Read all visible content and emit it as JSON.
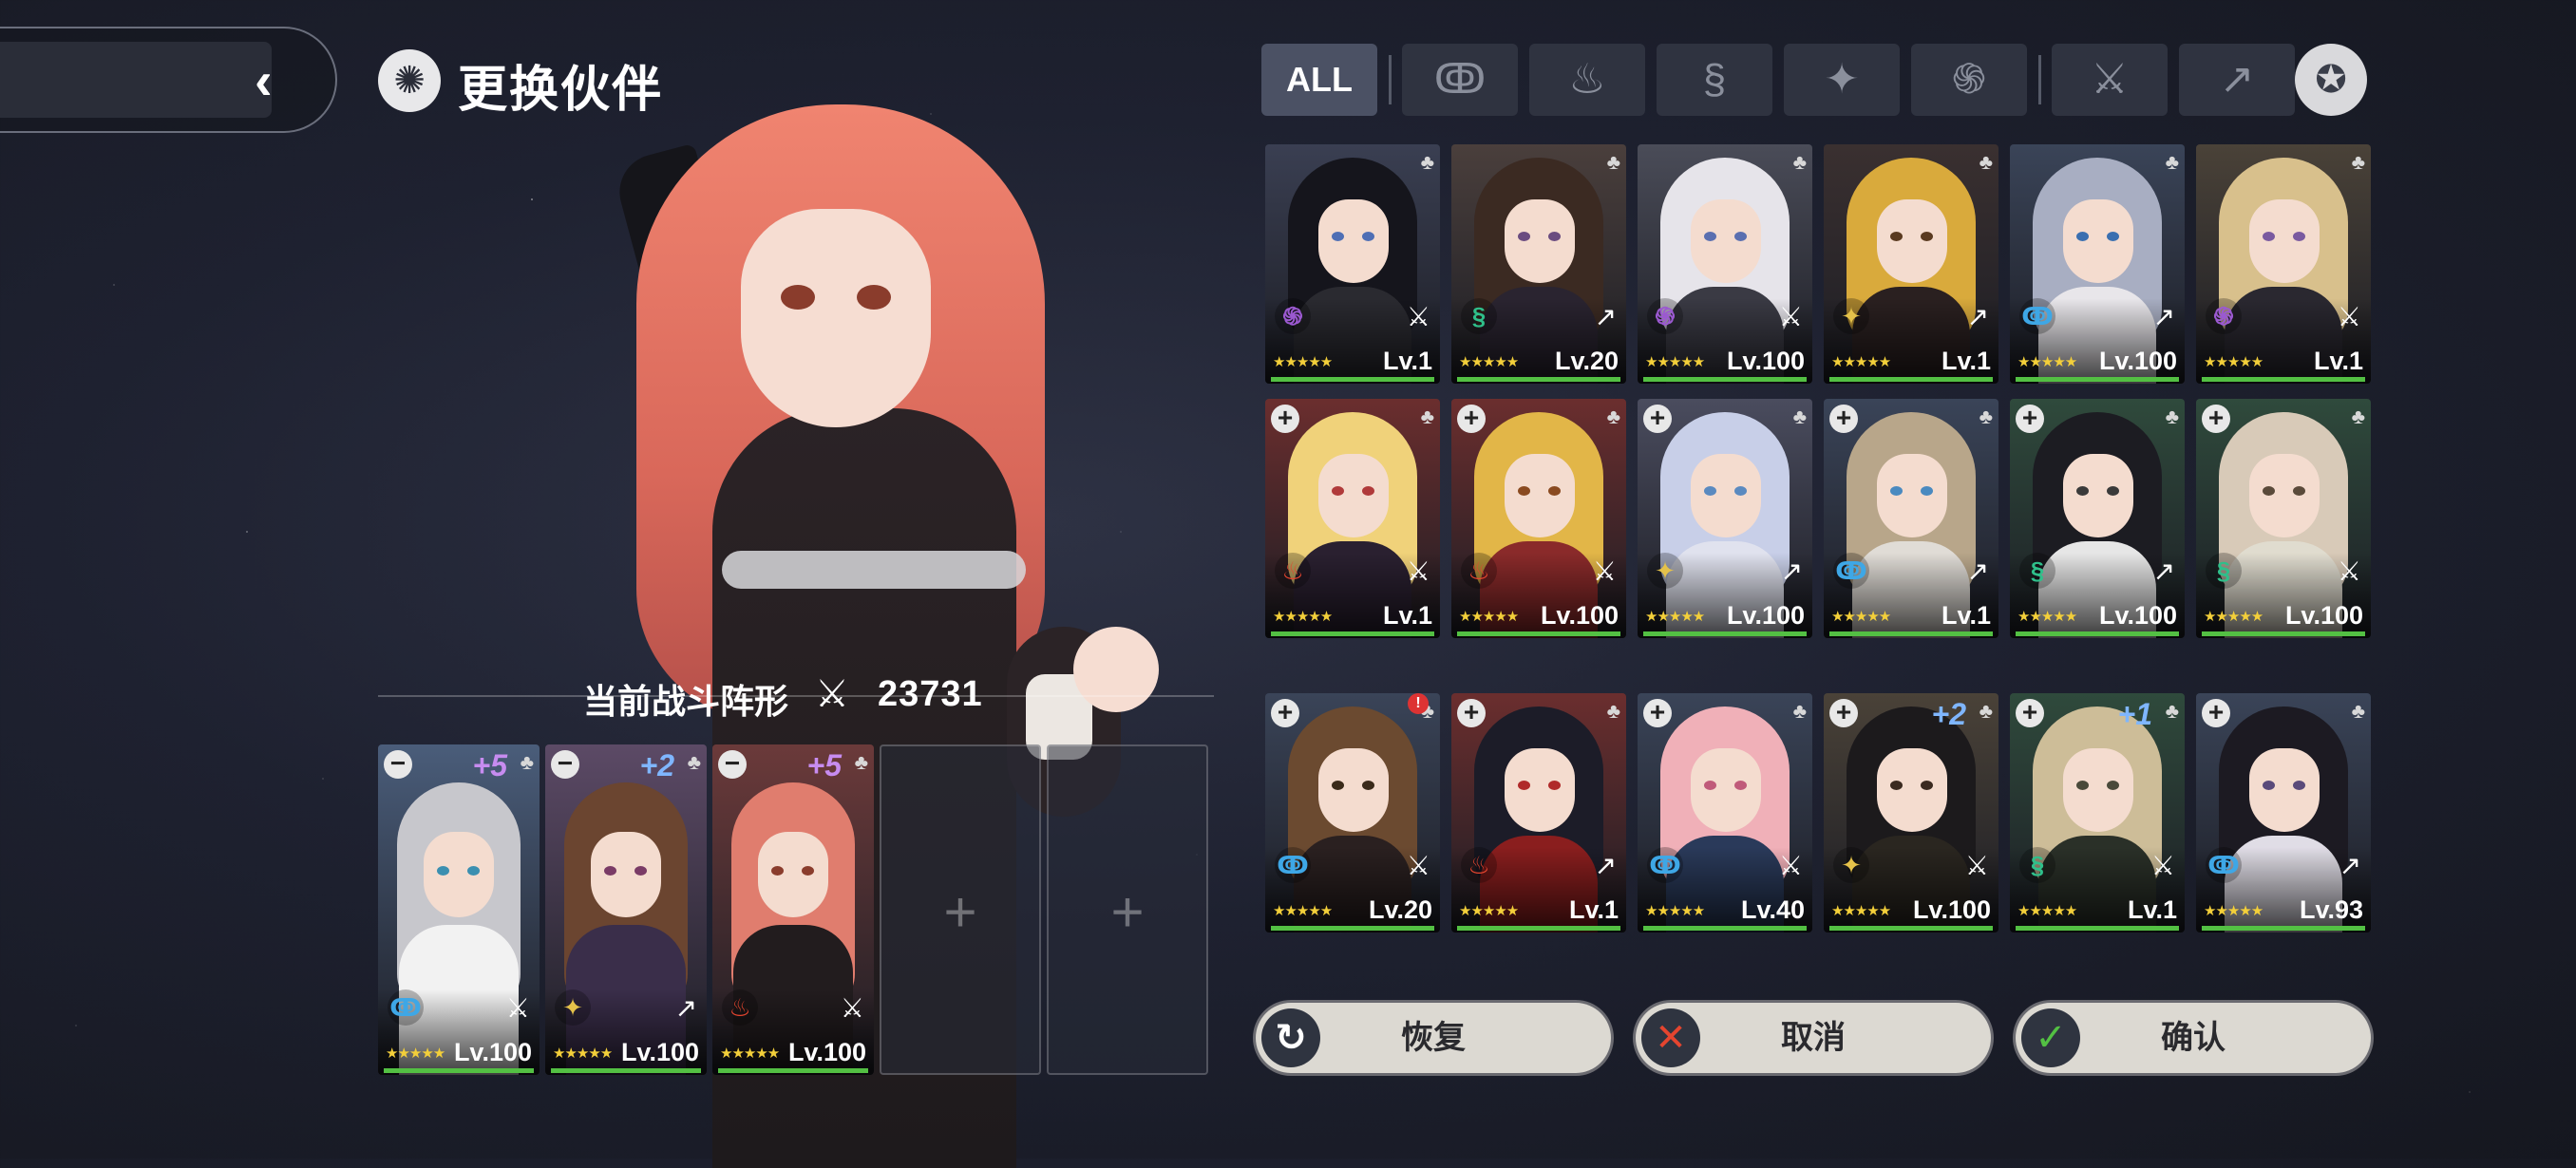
{
  "header": {
    "title": "更换伙伴"
  },
  "formation": {
    "label": "当前战斗阵形",
    "power": "23731"
  },
  "filters": [
    "ALL"
  ],
  "colors": {
    "water": "#3ea7e6",
    "fire": "#e5452f",
    "wind": "#2fbf8a",
    "light": "#e5c24a",
    "dark": "#9b59d0"
  },
  "team": [
    {
      "boost": "+5",
      "element": "water",
      "class": "sword",
      "stars": "★★★★★",
      "level": "Lv.100",
      "hair": "#c7c7cc",
      "bg": "#4a5d7a",
      "torso": "#f2f2f2",
      "eye": "#3b8fb0"
    },
    {
      "boost": "+2",
      "element": "light",
      "class": "lance",
      "stars": "★★★★★",
      "level": "Lv.100",
      "hair": "#6b4530",
      "bg": "#5c4a66",
      "torso": "#3a2e4a",
      "eye": "#7a3b66"
    },
    {
      "boost": "+5",
      "element": "fire",
      "class": "sword",
      "stars": "★★★★★",
      "level": "Lv.100",
      "hair": "#e07d6e",
      "bg": "#6b3a3a",
      "torso": "#221c1e",
      "eye": "#8a3c2c"
    }
  ],
  "roster": [
    {
      "element": "dark",
      "class": "sword",
      "stars": "★★★★★",
      "level": "Lv.1",
      "hair": "#15151c",
      "bg": "#3a3f52",
      "torso": "#2a2a30",
      "eye": "#4f6fb5",
      "action": "none"
    },
    {
      "element": "wind",
      "class": "lance",
      "stars": "★★★★★",
      "level": "Lv.20",
      "hair": "#3b2a22",
      "bg": "#4a3f3c",
      "torso": "#2a2430",
      "eye": "#6a4c80",
      "action": "none"
    },
    {
      "element": "dark",
      "class": "sword",
      "stars": "★★★★★",
      "level": "Lv.100",
      "hair": "#e6e4ea",
      "bg": "#4a4c58",
      "torso": "#3a3a44",
      "eye": "#5a6fb0",
      "action": "none"
    },
    {
      "element": "light",
      "class": "lance",
      "stars": "★★★★★",
      "level": "Lv.1",
      "hair": "#d9aa3c",
      "bg": "#3a3030",
      "torso": "#2a2020",
      "eye": "#5a3a20",
      "action": "none"
    },
    {
      "element": "water",
      "class": "lance",
      "stars": "★★★★★",
      "level": "Lv.100",
      "hair": "#a8aec2",
      "bg": "#3a4458",
      "torso": "#e8e6ea",
      "eye": "#3a6fb0",
      "action": "none"
    },
    {
      "element": "dark",
      "class": "sword",
      "stars": "★★★★★",
      "level": "Lv.1",
      "hair": "#d8c08c",
      "bg": "#4a4238",
      "torso": "#2a2830",
      "eye": "#7a5aa0",
      "action": "none"
    },
    {
      "element": "fire",
      "class": "sword",
      "stars": "★★★★★",
      "level": "Lv.1",
      "hair": "#f0d27a",
      "bg": "#6b2e2e",
      "torso": "#2a2030",
      "eye": "#b03a3a",
      "action": "add"
    },
    {
      "element": "fire",
      "class": "sword",
      "stars": "★★★★★",
      "level": "Lv.100",
      "hair": "#e2b648",
      "bg": "#6b2e2e",
      "torso": "#8a2a2a",
      "eye": "#8a4a20",
      "action": "add"
    },
    {
      "element": "light",
      "class": "lance",
      "stars": "★★★★★",
      "level": "Lv.100",
      "hair": "#c8cfe8",
      "bg": "#4a4c5e",
      "torso": "#e0e2ee",
      "eye": "#5a8ac0",
      "action": "add"
    },
    {
      "element": "water",
      "class": "lance",
      "stars": "★★★★★",
      "level": "Lv.1",
      "hair": "#b8a68a",
      "bg": "#3a4458",
      "torso": "#e0dcd6",
      "eye": "#4a8ac0",
      "action": "add"
    },
    {
      "element": "wind",
      "class": "lance",
      "stars": "★★★★★",
      "level": "Lv.100",
      "hair": "#1c1c22",
      "bg": "#2f4a3c",
      "torso": "#e6e6e6",
      "eye": "#3a3a3a",
      "action": "add"
    },
    {
      "element": "wind",
      "class": "sword",
      "stars": "★★★★★",
      "level": "Lv.100",
      "hair": "#d8cab8",
      "bg": "#2f4a3c",
      "torso": "#e0dccf",
      "eye": "#5a4a3a",
      "action": "add"
    },
    {
      "element": "water",
      "class": "sword",
      "stars": "★★★★★",
      "level": "Lv.20",
      "hair": "#6b4a30",
      "bg": "#3a4458",
      "torso": "#2a2020",
      "eye": "#3a2a1a",
      "action": "add",
      "alert": true
    },
    {
      "element": "fire",
      "class": "lance",
      "stars": "★★★★★",
      "level": "Lv.1",
      "hair": "#1c1c28",
      "bg": "#6b2e2e",
      "torso": "#8a1e1e",
      "eye": "#b02a2a",
      "action": "add"
    },
    {
      "element": "water",
      "class": "sword",
      "stars": "★★★★★",
      "level": "Lv.40",
      "hair": "#f0b0b8",
      "bg": "#3a4458",
      "torso": "#2a3a5a",
      "eye": "#c05a7a",
      "action": "add"
    },
    {
      "element": "light",
      "class": "sword",
      "stars": "★★★★★",
      "level": "Lv.100",
      "hair": "#1c1a1c",
      "bg": "#4a4238",
      "torso": "#2a2620",
      "eye": "#3a2a20",
      "action": "add",
      "boost": "+2"
    },
    {
      "element": "wind",
      "class": "sword",
      "stars": "★★★★★",
      "level": "Lv.1",
      "hair": "#cdbd98",
      "bg": "#2f4a3c",
      "torso": "#2a3028",
      "eye": "#4a4a3a",
      "action": "add",
      "boost": "+1"
    },
    {
      "element": "water",
      "class": "lance",
      "stars": "★★★★★",
      "level": "Lv.93",
      "hair": "#1c1a22",
      "bg": "#3a4458",
      "torso": "#e0dde6",
      "eye": "#5a4a7a",
      "action": "add"
    }
  ],
  "buttons": {
    "reset": "恢复",
    "cancel": "取消",
    "confirm": "确认"
  }
}
